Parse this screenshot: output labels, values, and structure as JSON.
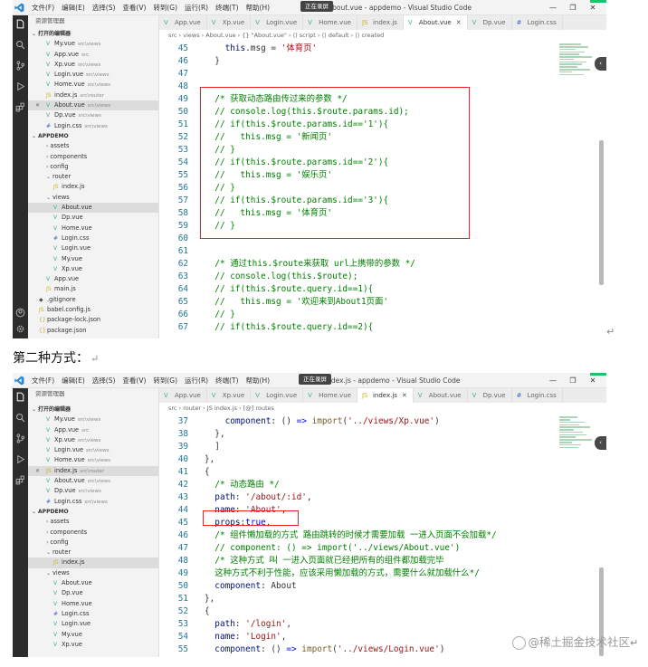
{
  "screenshot1": {
    "menu": [
      "文件(F)",
      "编辑(E)",
      "选择(S)",
      "查看(V)",
      "转到(G)",
      "运行(R)",
      "终端(T)",
      "帮助(H)"
    ],
    "window_title": "About.vue - appdemo - Visual Studio Code",
    "recording_badge": "正在录屏",
    "window_controls": [
      "—",
      "❐",
      "✕"
    ],
    "explorer_title": "资源管理器",
    "tree": [
      {
        "label": "打开的编辑器",
        "kind": "sec",
        "indent": 0,
        "chev": "⌄"
      },
      {
        "label": "My.vue",
        "path": "src\\views",
        "kind": "vue",
        "indent": 2
      },
      {
        "label": "App.vue",
        "path": "src",
        "kind": "vue",
        "indent": 2
      },
      {
        "label": "Xp.vue",
        "path": "src\\views",
        "kind": "vue",
        "indent": 2
      },
      {
        "label": "Login.vue",
        "path": "src\\views",
        "kind": "vue",
        "indent": 2
      },
      {
        "label": "Home.vue",
        "path": "src\\views",
        "kind": "vue",
        "indent": 2
      },
      {
        "label": "index.js",
        "path": "src\\router",
        "kind": "js",
        "indent": 2
      },
      {
        "label": "About.vue",
        "path": "src\\views",
        "kind": "vue",
        "indent": 2,
        "selected": true,
        "close": "✕"
      },
      {
        "label": "Dp.vue",
        "path": "src\\views",
        "kind": "vue",
        "indent": 2
      },
      {
        "label": "Login.css",
        "path": "src\\views",
        "kind": "css",
        "indent": 2
      },
      {
        "label": "APPDEMO",
        "kind": "sec",
        "indent": 0,
        "chev": "⌄"
      },
      {
        "label": "assets",
        "kind": "folder",
        "indent": 2,
        "chev": "›"
      },
      {
        "label": "components",
        "kind": "folder",
        "indent": 2,
        "chev": "›"
      },
      {
        "label": "config",
        "kind": "folder",
        "indent": 2,
        "chev": "›"
      },
      {
        "label": "router",
        "kind": "folder",
        "indent": 2,
        "chev": "⌄"
      },
      {
        "label": "index.js",
        "kind": "js",
        "indent": 3
      },
      {
        "label": "views",
        "kind": "folder",
        "indent": 2,
        "chev": "⌄"
      },
      {
        "label": "About.vue",
        "kind": "vue",
        "indent": 3,
        "selected": true
      },
      {
        "label": "Dp.vue",
        "kind": "vue",
        "indent": 3
      },
      {
        "label": "Home.vue",
        "kind": "vue",
        "indent": 3
      },
      {
        "label": "Login.css",
        "kind": "css",
        "indent": 3
      },
      {
        "label": "Login.vue",
        "kind": "vue",
        "indent": 3
      },
      {
        "label": "My.vue",
        "kind": "vue",
        "indent": 3
      },
      {
        "label": "Xp.vue",
        "kind": "vue",
        "indent": 3
      },
      {
        "label": "App.vue",
        "kind": "vue",
        "indent": 2
      },
      {
        "label": "main.js",
        "kind": "js",
        "indent": 2
      },
      {
        "label": ".gitignore",
        "kind": "git",
        "indent": 1
      },
      {
        "label": "babel.config.js",
        "kind": "js",
        "indent": 1
      },
      {
        "label": "package-lock.json",
        "kind": "json",
        "indent": 1
      },
      {
        "label": "package.json",
        "kind": "json",
        "indent": 1
      }
    ],
    "tabs": [
      {
        "label": "App.vue",
        "icon": "V",
        "kind": "vue"
      },
      {
        "label": "Xp.vue",
        "icon": "V",
        "kind": "vue"
      },
      {
        "label": "Login.vue",
        "icon": "V",
        "kind": "vue"
      },
      {
        "label": "Home.vue",
        "icon": "V",
        "kind": "vue"
      },
      {
        "label": "index.js",
        "icon": "JS",
        "kind": "js"
      },
      {
        "label": "About.vue",
        "icon": "V",
        "kind": "vue",
        "active": true,
        "close": "✕"
      },
      {
        "label": "Dp.vue",
        "icon": "V",
        "kind": "vue"
      },
      {
        "label": "Login.css",
        "icon": "#",
        "kind": "css"
      }
    ],
    "breadcrumb": "src › views › About.vue › {} \"About.vue\" › ⟨⟩ script › ⟨⟩ default › ⟨⟩ created",
    "code": [
      {
        "ln": "45",
        "tokens": [
          [
            "",
            "    "
          ],
          [
            "prop",
            "this"
          ],
          [
            "plain",
            ".msg = "
          ],
          [
            "str",
            "'体育页'"
          ]
        ]
      },
      {
        "ln": "46",
        "tokens": [
          [
            "",
            "  "
          ],
          [
            "plain",
            "}"
          ]
        ]
      },
      {
        "ln": "47",
        "tokens": []
      },
      {
        "ln": "48",
        "tokens": []
      },
      {
        "ln": "49",
        "tokens": [
          [
            "",
            "  "
          ],
          [
            "cm",
            "/* 获取动态路由传过来的参数 */"
          ]
        ]
      },
      {
        "ln": "50",
        "tokens": [
          [
            "",
            "  "
          ],
          [
            "cm",
            "// console.log(this.$route.params.id);"
          ]
        ]
      },
      {
        "ln": "51",
        "tokens": [
          [
            "",
            "  "
          ],
          [
            "cm",
            "// if(this.$route.params.id=='1'){"
          ]
        ]
      },
      {
        "ln": "52",
        "tokens": [
          [
            "",
            "  "
          ],
          [
            "cm",
            "//   this.msg = '新闻页'"
          ]
        ]
      },
      {
        "ln": "53",
        "tokens": [
          [
            "",
            "  "
          ],
          [
            "cm",
            "// }"
          ]
        ]
      },
      {
        "ln": "54",
        "tokens": [
          [
            "",
            "  "
          ],
          [
            "cm",
            "// if(this.$route.params.id=='2'){"
          ]
        ]
      },
      {
        "ln": "55",
        "tokens": [
          [
            "",
            "  "
          ],
          [
            "cm",
            "//   this.msg = '娱乐页'"
          ]
        ]
      },
      {
        "ln": "56",
        "tokens": [
          [
            "",
            "  "
          ],
          [
            "cm",
            "// }"
          ]
        ]
      },
      {
        "ln": "57",
        "tokens": [
          [
            "",
            "  "
          ],
          [
            "cm",
            "// if(this.$route.params.id=='3'){"
          ]
        ]
      },
      {
        "ln": "58",
        "tokens": [
          [
            "",
            "  "
          ],
          [
            "cm",
            "//   this.msg = '体育页'"
          ]
        ]
      },
      {
        "ln": "59",
        "tokens": [
          [
            "",
            "  "
          ],
          [
            "cm",
            "// }"
          ]
        ]
      },
      {
        "ln": "60",
        "tokens": []
      },
      {
        "ln": "61",
        "tokens": []
      },
      {
        "ln": "62",
        "tokens": [
          [
            "",
            "  "
          ],
          [
            "cm",
            "/* 通过this.$route来获取 url上携带的参数 */"
          ]
        ]
      },
      {
        "ln": "63",
        "tokens": [
          [
            "",
            "  "
          ],
          [
            "cm",
            "// console.log(this.$route);"
          ]
        ]
      },
      {
        "ln": "64",
        "tokens": [
          [
            "",
            "  "
          ],
          [
            "cm",
            "// if(this.$route.query.id==1){"
          ]
        ]
      },
      {
        "ln": "65",
        "tokens": [
          [
            "",
            "  "
          ],
          [
            "cm",
            "//   this.msg = '欢迎来到About1页面'"
          ]
        ]
      },
      {
        "ln": "66",
        "tokens": [
          [
            "",
            "  "
          ],
          [
            "cm",
            "// }"
          ]
        ]
      },
      {
        "ln": "67",
        "tokens": [
          [
            "",
            "  "
          ],
          [
            "cm",
            "// if(this.$route.query.id==2){"
          ]
        ]
      }
    ]
  },
  "caption": "第二种方式：",
  "return_mark": "↵",
  "screenshot2": {
    "menu": [
      "文件(F)",
      "编辑(E)",
      "选择(S)",
      "查看(V)",
      "转到(G)",
      "运行(R)",
      "终端(T)",
      "帮助(H)"
    ],
    "window_title": "index.js - appdemo - Visual Studio Code",
    "recording_badge": "正在录屏",
    "window_controls": [
      "—",
      "❐",
      "✕"
    ],
    "explorer_title": "资源管理器",
    "tree": [
      {
        "label": "打开的编辑器",
        "kind": "sec",
        "indent": 0,
        "chev": "⌄"
      },
      {
        "label": "My.vue",
        "path": "src\\views",
        "kind": "vue",
        "indent": 2
      },
      {
        "label": "App.vue",
        "path": "src",
        "kind": "vue",
        "indent": 2
      },
      {
        "label": "Xp.vue",
        "path": "src\\views",
        "kind": "vue",
        "indent": 2
      },
      {
        "label": "Login.vue",
        "path": "src\\views",
        "kind": "vue",
        "indent": 2
      },
      {
        "label": "Home.vue",
        "path": "src\\views",
        "kind": "vue",
        "indent": 2
      },
      {
        "label": "index.js",
        "path": "src\\router",
        "kind": "js",
        "indent": 2,
        "selected": true,
        "close": "✕"
      },
      {
        "label": "About.vue",
        "path": "src\\views",
        "kind": "vue",
        "indent": 2
      },
      {
        "label": "Dp.vue",
        "path": "src\\views",
        "kind": "vue",
        "indent": 2
      },
      {
        "label": "Login.css",
        "path": "src\\views",
        "kind": "css",
        "indent": 2
      },
      {
        "label": "APPDEMO",
        "kind": "sec",
        "indent": 0,
        "chev": "⌄"
      },
      {
        "label": "assets",
        "kind": "folder",
        "indent": 2,
        "chev": "›"
      },
      {
        "label": "components",
        "kind": "folder",
        "indent": 2,
        "chev": "›"
      },
      {
        "label": "config",
        "kind": "folder",
        "indent": 2,
        "chev": "›"
      },
      {
        "label": "router",
        "kind": "folder",
        "indent": 2,
        "chev": "⌄"
      },
      {
        "label": "index.js",
        "kind": "js",
        "indent": 3,
        "selected": true
      },
      {
        "label": "views",
        "kind": "folder",
        "indent": 2,
        "chev": "⌄"
      },
      {
        "label": "About.vue",
        "kind": "vue",
        "indent": 3
      },
      {
        "label": "Dp.vue",
        "kind": "vue",
        "indent": 3
      },
      {
        "label": "Home.vue",
        "kind": "vue",
        "indent": 3
      },
      {
        "label": "Login.css",
        "kind": "css",
        "indent": 3
      },
      {
        "label": "Login.vue",
        "kind": "vue",
        "indent": 3
      },
      {
        "label": "My.vue",
        "kind": "vue",
        "indent": 3
      },
      {
        "label": "Xp.vue",
        "kind": "vue",
        "indent": 3
      }
    ],
    "tabs": [
      {
        "label": "App.vue",
        "icon": "V",
        "kind": "vue"
      },
      {
        "label": "Xp.vue",
        "icon": "V",
        "kind": "vue"
      },
      {
        "label": "Login.vue",
        "icon": "V",
        "kind": "vue"
      },
      {
        "label": "Home.vue",
        "icon": "V",
        "kind": "vue"
      },
      {
        "label": "index.js",
        "icon": "JS",
        "kind": "js",
        "active": true,
        "close": "✕"
      },
      {
        "label": "About.vue",
        "icon": "V",
        "kind": "vue"
      },
      {
        "label": "Dp.vue",
        "icon": "V",
        "kind": "vue"
      },
      {
        "label": "Login.css",
        "icon": "#",
        "kind": "css"
      }
    ],
    "breadcrumb": "src › router › JS index.js › [@] routes",
    "code": [
      {
        "ln": "37",
        "tokens": [
          [
            "",
            "    "
          ],
          [
            "prop",
            "component"
          ],
          [
            "plain",
            ": () "
          ],
          [
            "kw",
            "=>"
          ],
          [
            "plain",
            " "
          ],
          [
            "fn",
            "import"
          ],
          [
            "plain",
            "("
          ],
          [
            "str",
            "'../views/Xp.vue'"
          ],
          [
            "plain",
            ")"
          ]
        ]
      },
      {
        "ln": "38",
        "tokens": [
          [
            "",
            "  "
          ],
          [
            "plain",
            "},"
          ]
        ]
      },
      {
        "ln": "39",
        "tokens": [
          [
            "",
            "  "
          ],
          [
            "plain",
            "]"
          ]
        ]
      },
      {
        "ln": "40",
        "tokens": [
          [
            "plain",
            "},"
          ]
        ]
      },
      {
        "ln": "41",
        "tokens": [
          [
            "plain",
            "{"
          ]
        ]
      },
      {
        "ln": "42",
        "tokens": [
          [
            "",
            "  "
          ],
          [
            "cm",
            "/* 动态路由 */"
          ]
        ]
      },
      {
        "ln": "43",
        "tokens": [
          [
            "",
            "  "
          ],
          [
            "prop",
            "path"
          ],
          [
            "plain",
            ": "
          ],
          [
            "str",
            "'/about/:id'"
          ],
          [
            "plain",
            ","
          ]
        ]
      },
      {
        "ln": "44",
        "tokens": [
          [
            "",
            "  "
          ],
          [
            "prop",
            "name"
          ],
          [
            "plain",
            ": "
          ],
          [
            "str",
            "'About'"
          ],
          [
            "plain",
            ","
          ]
        ]
      },
      {
        "ln": "45",
        "tokens": [
          [
            "",
            "  "
          ],
          [
            "prop",
            "props"
          ],
          [
            "plain",
            ":"
          ],
          [
            "kw",
            "true"
          ],
          [
            "plain",
            ","
          ]
        ]
      },
      {
        "ln": "46",
        "tokens": [
          [
            "",
            "  "
          ],
          [
            "cm",
            "/* 组件懒加载的方式 路由跳转的时候才需要加载 一进入页面不会加载*/"
          ]
        ]
      },
      {
        "ln": "47",
        "tokens": [
          [
            "",
            "  "
          ],
          [
            "cm",
            "// component: () => import('../views/About.vue')"
          ]
        ]
      },
      {
        "ln": "48",
        "tokens": [
          [
            "",
            "  "
          ],
          [
            "cm",
            "/* 这种方式 叫 一进入页面就已经把所有的组件都加载完毕"
          ]
        ]
      },
      {
        "ln": "49",
        "tokens": [
          [
            "",
            "  "
          ],
          [
            "cm",
            "这种方式不利于性能，应该采用懒加载的方式，需要什么就加载什么*/"
          ]
        ]
      },
      {
        "ln": "50",
        "tokens": [
          [
            "",
            "  "
          ],
          [
            "prop",
            "component"
          ],
          [
            "plain",
            ": About"
          ]
        ]
      },
      {
        "ln": "51",
        "tokens": [
          [
            "plain",
            "},"
          ]
        ]
      },
      {
        "ln": "52",
        "tokens": [
          [
            "plain",
            "{"
          ]
        ]
      },
      {
        "ln": "53",
        "tokens": [
          [
            "",
            "  "
          ],
          [
            "prop",
            "path"
          ],
          [
            "plain",
            ": "
          ],
          [
            "str",
            "'/login'"
          ],
          [
            "plain",
            ","
          ]
        ]
      },
      {
        "ln": "54",
        "tokens": [
          [
            "",
            "  "
          ],
          [
            "prop",
            "name"
          ],
          [
            "plain",
            ": "
          ],
          [
            "str",
            "'Login'"
          ],
          [
            "plain",
            ","
          ]
        ]
      },
      {
        "ln": "55",
        "tokens": [
          [
            "",
            "  "
          ],
          [
            "prop",
            "component"
          ],
          [
            "plain",
            ": () "
          ],
          [
            "kw",
            "=>"
          ],
          [
            "plain",
            " "
          ],
          [
            "fn",
            "import"
          ],
          [
            "plain",
            "("
          ],
          [
            "str",
            "'../views/Login.vue'"
          ],
          [
            "plain",
            ")"
          ]
        ]
      }
    ]
  },
  "watermark": "@稀土掘金技术社区",
  "colors": {
    "comment": "#008000",
    "keyword": "#0000ff",
    "string": "#a31515",
    "property": "#001080",
    "line_number": "#237893",
    "highlight_box": "#e22222",
    "activity_bar": "#2c2c2c",
    "sidebar": "#f3f3f3",
    "accent_green": "#1ec26a"
  },
  "icons": [
    "vscode-logo-icon",
    "explorer-icon",
    "search-icon",
    "source-control-icon",
    "run-debug-icon",
    "extensions-icon",
    "account-icon",
    "settings-gear-icon",
    "close-icon"
  ]
}
